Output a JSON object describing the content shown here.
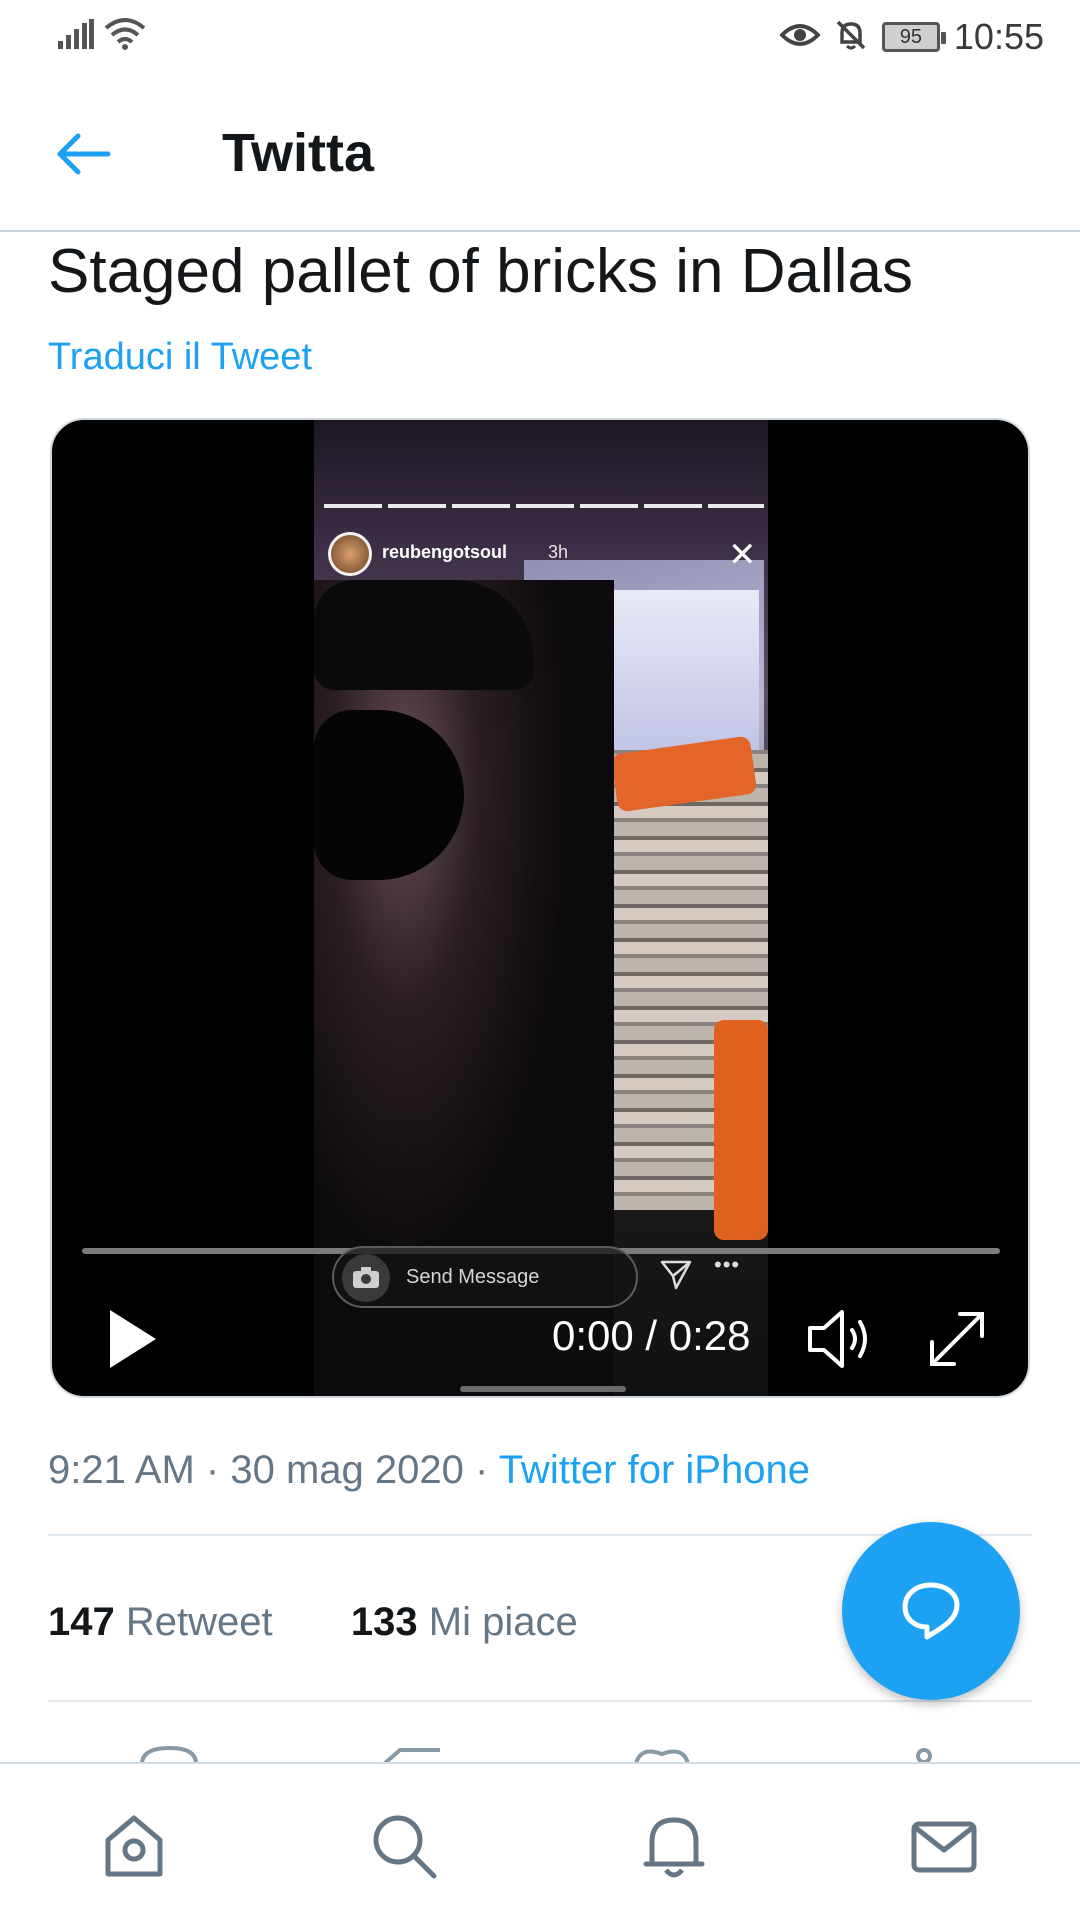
{
  "status_bar": {
    "time": "10:55",
    "battery": "95",
    "icons": [
      "signal-icon",
      "wifi-icon",
      "eye-icon",
      "bell-off-icon",
      "battery-icon"
    ]
  },
  "header": {
    "back_icon": "arrow-left-icon",
    "title": "Twitta"
  },
  "tweet": {
    "text": "Staged pallet of bricks in Dallas",
    "translate_label": "Traduci il Tweet"
  },
  "video": {
    "story_username": "reubengotsoul",
    "story_age": "3h",
    "send_message_placeholder": "Send Message",
    "time": "0:00 / 0:28",
    "progress": 0,
    "controls": [
      "play-icon",
      "volume-icon",
      "fullscreen-icon"
    ]
  },
  "meta": {
    "time": "9:21 AM",
    "date": "30 mag 2020",
    "separator": "·",
    "source": "Twitter for iPhone"
  },
  "stats": {
    "retweets_count": "147",
    "retweets_label": "Retweet",
    "likes_count": "133",
    "likes_label": "Mi piace"
  },
  "fab_icon": "compose-reply-icon",
  "bottom_nav": [
    "home-icon",
    "search-icon",
    "notifications-icon",
    "messages-icon"
  ],
  "colors": {
    "accent": "#1da1f2",
    "text_primary": "#14171a",
    "text_secondary": "#657786",
    "divider": "#e1e8ed"
  }
}
